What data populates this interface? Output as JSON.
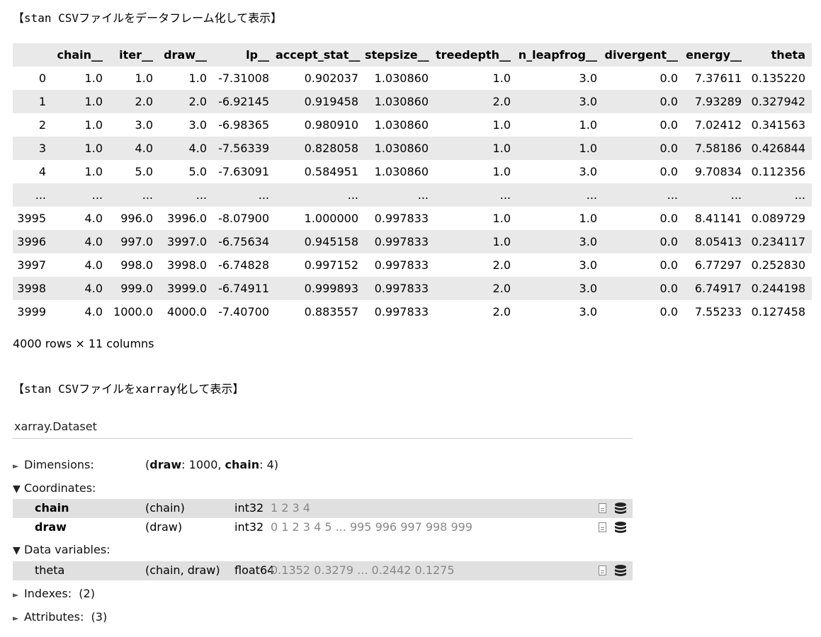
{
  "title_dataframe": "【stan CSVファイルをデータフレーム化して表示】",
  "title_xarray": "【stan CSVファイルをxarray化して表示】",
  "dataframe": {
    "columns": [
      "",
      "chain__",
      "iter__",
      "draw__",
      "lp__",
      "accept_stat__",
      "stepsize__",
      "treedepth__",
      "n_leapfrog__",
      "divergent__",
      "energy__",
      "theta"
    ],
    "rows": [
      [
        "0",
        "1.0",
        "1.0",
        "1.0",
        "-7.31008",
        "0.902037",
        "1.030860",
        "1.0",
        "3.0",
        "0.0",
        "7.37611",
        "0.135220"
      ],
      [
        "1",
        "1.0",
        "2.0",
        "2.0",
        "-6.92145",
        "0.919458",
        "1.030860",
        "2.0",
        "3.0",
        "0.0",
        "7.93289",
        "0.327942"
      ],
      [
        "2",
        "1.0",
        "3.0",
        "3.0",
        "-6.98365",
        "0.980910",
        "1.030860",
        "1.0",
        "1.0",
        "0.0",
        "7.02412",
        "0.341563"
      ],
      [
        "3",
        "1.0",
        "4.0",
        "4.0",
        "-7.56339",
        "0.828058",
        "1.030860",
        "1.0",
        "1.0",
        "0.0",
        "7.58186",
        "0.426844"
      ],
      [
        "4",
        "1.0",
        "5.0",
        "5.0",
        "-7.63091",
        "0.584951",
        "1.030860",
        "1.0",
        "3.0",
        "0.0",
        "9.70834",
        "0.112356"
      ],
      [
        "...",
        "...",
        "...",
        "...",
        "...",
        "...",
        "...",
        "...",
        "...",
        "...",
        "...",
        "..."
      ],
      [
        "3995",
        "4.0",
        "996.0",
        "3996.0",
        "-8.07900",
        "1.000000",
        "0.997833",
        "1.0",
        "1.0",
        "0.0",
        "8.41141",
        "0.089729"
      ],
      [
        "3996",
        "4.0",
        "997.0",
        "3997.0",
        "-6.75634",
        "0.945158",
        "0.997833",
        "1.0",
        "3.0",
        "0.0",
        "8.05413",
        "0.234117"
      ],
      [
        "3997",
        "4.0",
        "998.0",
        "3998.0",
        "-6.74828",
        "0.997152",
        "0.997833",
        "2.0",
        "3.0",
        "0.0",
        "6.77297",
        "0.252830"
      ],
      [
        "3998",
        "4.0",
        "999.0",
        "3999.0",
        "-6.74911",
        "0.999893",
        "0.997833",
        "2.0",
        "3.0",
        "0.0",
        "6.74917",
        "0.244198"
      ],
      [
        "3999",
        "4.0",
        "1000.0",
        "4000.0",
        "-7.40700",
        "0.883557",
        "0.997833",
        "2.0",
        "3.0",
        "0.0",
        "7.55233",
        "0.127458"
      ]
    ],
    "shape_text": "4000 rows × 11 columns"
  },
  "xarray": {
    "name": "xarray.Dataset",
    "dimensions": {
      "label": "Dimensions:",
      "open_paren": "(",
      "dim1_name": "draw",
      "dim1_rest": ": 1000, ",
      "dim2_name": "chain",
      "dim2_rest": ": 4)"
    },
    "coordinates": {
      "label": "Coordinates:",
      "items": [
        {
          "name": "chain",
          "dims": "(chain)",
          "dtype": "int32",
          "preview": "1 2 3 4"
        },
        {
          "name": "draw",
          "dims": "(draw)",
          "dtype": "int32",
          "preview": "0 1 2 3 4 5 ... 995 996 997 998 999"
        }
      ]
    },
    "data_variables": {
      "label": "Data variables:",
      "items": [
        {
          "name": "theta",
          "dims": "(chain, draw)",
          "dtype": "float64",
          "preview": "0.1352 0.3279 ... 0.2442 0.1275"
        }
      ]
    },
    "indexes": {
      "label": "Indexes:",
      "count": "(2)"
    },
    "attributes": {
      "label": "Attributes:",
      "count": "(3)"
    },
    "arrow_collapsed": "►",
    "arrow_expanded": "▼",
    "icons": [
      "file-text-icon",
      "database-icon"
    ]
  }
}
